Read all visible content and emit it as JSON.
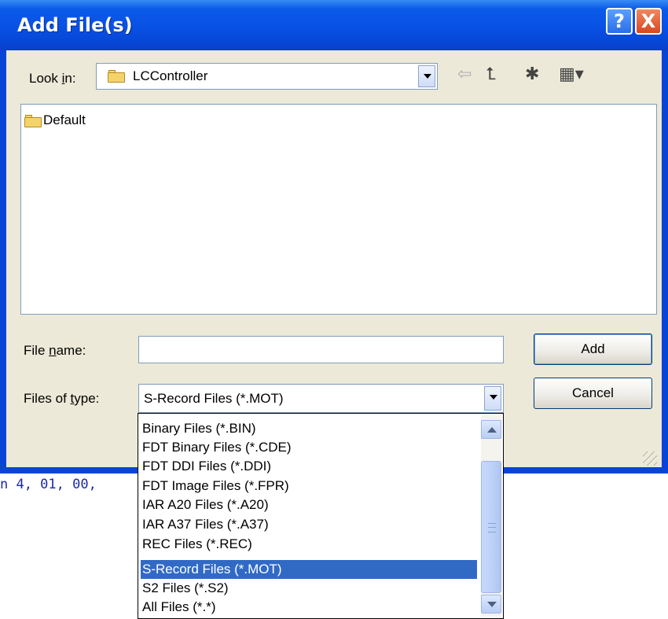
{
  "dialog": {
    "title": "Add File(s)",
    "help_glyph": "?",
    "close_glyph": "X"
  },
  "look_in": {
    "label_pre": "Look ",
    "label_key": "i",
    "label_post": "n:",
    "value": "LCController"
  },
  "toolbar": {
    "back_icon": "back-arrow-icon",
    "up_icon": "up-folder-icon",
    "new_folder_icon": "new-folder-icon",
    "view_menu_icon": "view-menu-icon",
    "back_glyph": "⇦",
    "up_glyph": "⮤",
    "new_folder_glyph": "✱",
    "view_glyph": "▦▾"
  },
  "file_list": [
    {
      "name": "Default",
      "icon": "folder-icon"
    }
  ],
  "file_name": {
    "label_pre": "File ",
    "label_key": "n",
    "label_post": "ame:",
    "value": ""
  },
  "files_of_type": {
    "label_pre": "Files of ",
    "label_key": "t",
    "label_post": "ype:",
    "selected": "S-Record Files (*.MOT)",
    "options": [
      "Binary Files (*.BIN)",
      "FDT Binary Files (*.CDE)",
      "FDT DDI Files (*.DDI)",
      "FDT Image Files (*.FPR)",
      "IAR A20 Files (*.A20)",
      "IAR A37 Files (*.A37)",
      "REC Files (*.REC)",
      "S-Record Files (*.MOT)",
      "S2 Files (*.S2)",
      "All Files (*.*)"
    ],
    "highlighted_index": 7
  },
  "buttons": {
    "add": "Add",
    "cancel": "Cancel"
  },
  "background_text": "n 4, 01, 00,"
}
